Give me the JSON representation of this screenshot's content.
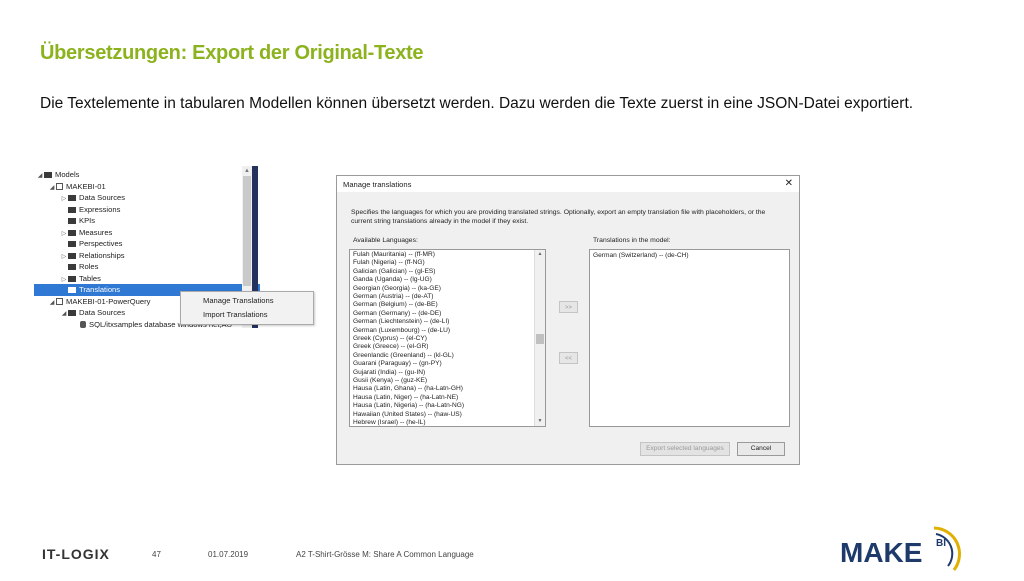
{
  "slide": {
    "title": "Übersetzungen: Export der Original-Texte",
    "body": "Die Textelemente in tabularen Modellen können übersetzt werden. Dazu werden die Texte zuerst in eine JSON-Datei exportiert."
  },
  "tree": {
    "items": [
      {
        "label": "Models",
        "icon": "models-folder-icon",
        "toggle": "◢"
      },
      {
        "label": "MAKEBI-01",
        "icon": "model-cube-icon",
        "toggle": "◢"
      },
      {
        "label": "Data Sources",
        "icon": "folder-icon",
        "toggle": "▷"
      },
      {
        "label": "Expressions",
        "icon": "folder-icon",
        "toggle": ""
      },
      {
        "label": "KPIs",
        "icon": "folder-icon",
        "toggle": ""
      },
      {
        "label": "Measures",
        "icon": "folder-icon",
        "toggle": "▷"
      },
      {
        "label": "Perspectives",
        "icon": "folder-icon",
        "toggle": ""
      },
      {
        "label": "Relationships",
        "icon": "folder-icon",
        "toggle": "▷"
      },
      {
        "label": "Roles",
        "icon": "folder-icon",
        "toggle": ""
      },
      {
        "label": "Tables",
        "icon": "folder-icon",
        "toggle": "▷"
      },
      {
        "label": "Translations",
        "icon": "folder-icon",
        "toggle": "",
        "selected": true
      },
      {
        "label": "MAKEBI-01-PowerQuery",
        "icon": "model-cube-icon",
        "toggle": "◢"
      },
      {
        "label": "Data Sources",
        "icon": "folder-icon",
        "toggle": "◢"
      },
      {
        "label": "SQL/itxsamples database windows net;AU",
        "icon": "datasource-icon",
        "toggle": ""
      }
    ]
  },
  "context_menu": {
    "items": [
      "Manage Translations",
      "Import Translations"
    ]
  },
  "dialog": {
    "title": "Manage translations",
    "close": "✕",
    "description": "Specifies the languages for which you are providing translated strings. Optionally, export an empty translation file with placeholders, or the current string translations already in the model if they exist.",
    "available_label": "Available Languages:",
    "translations_label": "Translations in the model:",
    "available_languages": [
      "Fulah (Mauritania) -- (ff-MR)",
      "Fulah (Nigeria) -- (ff-NG)",
      "Galician (Galician) -- (gl-ES)",
      "Ganda (Uganda) -- (lg-UG)",
      "Georgian (Georgia) -- (ka-GE)",
      "German (Austria) -- (de-AT)",
      "German (Belgium) -- (de-BE)",
      "German (Germany) -- (de-DE)",
      "German (Liechtenstein) -- (de-LI)",
      "German (Luxembourg) -- (de-LU)",
      "Greek (Cyprus) -- (el-CY)",
      "Greek (Greece) -- (el-GR)",
      "Greenlandic (Greenland) -- (kl-GL)",
      "Guarani (Paraguay) -- (gn-PY)",
      "Gujarati (India) -- (gu-IN)",
      "Gusii (Kenya) -- (guz-KE)",
      "Hausa (Latin, Ghana) -- (ha-Latn-GH)",
      "Hausa (Latin, Niger) -- (ha-Latn-NE)",
      "Hausa (Latin, Nigeria) -- (ha-Latn-NG)",
      "Hawaiian (United States) -- (haw-US)",
      "Hebrew (Israel) -- (he-IL)"
    ],
    "translations": [
      "German (Switzerland) -- (de-CH)"
    ],
    "add_button": ">>",
    "remove_button": "<<",
    "export_button": "Export selected languages",
    "cancel_button": "Cancel"
  },
  "footer": {
    "company": "IT-LOGIX",
    "page": "47",
    "date": "01.07.2019",
    "text": "A2 T-Shirt-Grösse M: Share A Common Language",
    "logo_text": "MAKE",
    "logo_sup": "BI"
  },
  "colors": {
    "title_green": "#8cb21e",
    "selection_blue": "#2f78d4",
    "logo_navy": "#1d3a6b",
    "logo_gold": "#e0b000"
  }
}
